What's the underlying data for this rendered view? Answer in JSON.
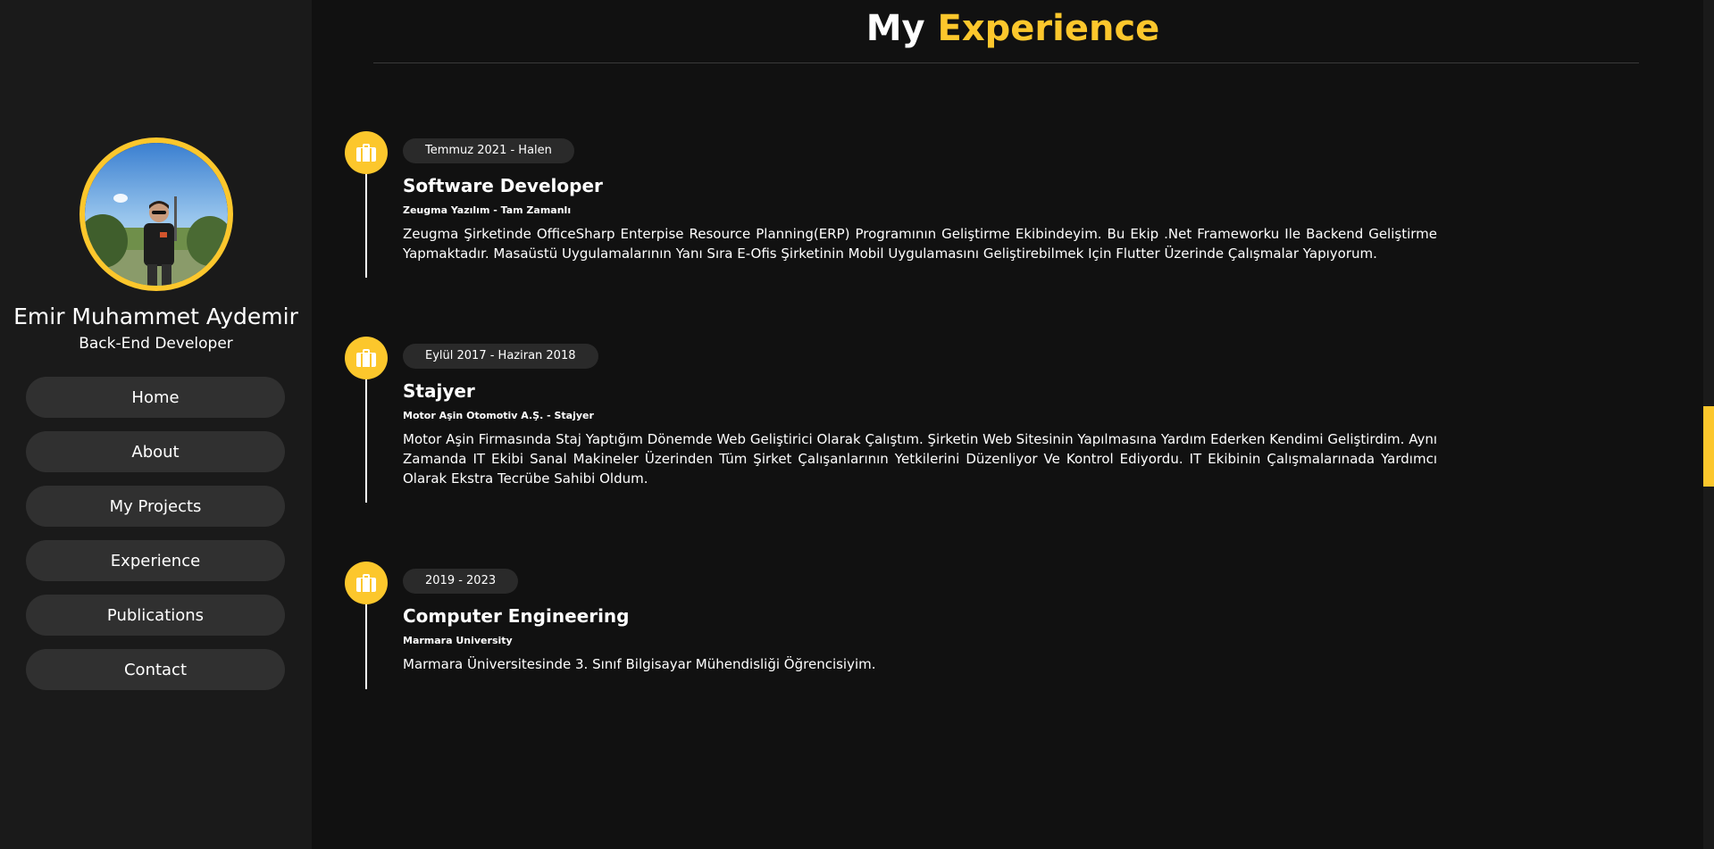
{
  "theme": {
    "accent": "#fcc72c",
    "background": "#111111",
    "sidebar": "#1a1a1a",
    "button": "#303030"
  },
  "profile": {
    "name": "Emir Muhammet Aydemir",
    "role": "Back-End Developer",
    "avatar_icon": "profile-photo"
  },
  "nav": {
    "items": [
      {
        "label": "Home"
      },
      {
        "label": "About"
      },
      {
        "label": "My Projects"
      },
      {
        "label": "Experience"
      },
      {
        "label": "Publications"
      },
      {
        "label": "Contact"
      }
    ]
  },
  "page": {
    "title_prefix": "My",
    "title_accent": "Experience"
  },
  "experiences": [
    {
      "icon": "briefcase-icon",
      "date": "Temmuz 2021 - Halen",
      "title": "Software Developer",
      "company": "Zeugma Yazılım - Tam Zamanlı",
      "description": "Zeugma Şirketinde OfficeSharp Enterpise Resource Planning(ERP) Programının Geliştirme Ekibindeyim. Bu Ekip .Net Frameworku Ile Backend Geliştirme Yapmaktadır. Masaüstü Uygulamalarının Yanı Sıra E-Ofis Şirketinin Mobil Uygulamasını Geliştirebilmek Için Flutter Üzerinde Çalışmalar Yapıyorum."
    },
    {
      "icon": "briefcase-icon",
      "date": "Eylül 2017 - Haziran 2018",
      "title": "Stajyer",
      "company": "Motor Aşin Otomotiv A.Ş. - Stajyer",
      "description": "Motor Aşin Firmasında Staj Yaptığım Dönemde Web Geliştirici Olarak Çalıştım. Şirketin Web Sitesinin Yapılmasına Yardım Ederken Kendimi Geliştirdim. Aynı Zamanda IT Ekibi Sanal Makineler Üzerinden Tüm Şirket Çalışanlarının Yetkilerini Düzenliyor Ve Kontrol Ediyordu. IT Ekibinin Çalışmalarınada Yardımcı Olarak Ekstra Tecrübe Sahibi Oldum."
    },
    {
      "icon": "briefcase-icon",
      "date": "2019 - 2023",
      "title": "Computer Engineering",
      "company": "Marmara University",
      "description": "Marmara Üniversitesinde 3. Sınıf Bilgisayar Mühendisliği Öğrencisiyim."
    }
  ]
}
